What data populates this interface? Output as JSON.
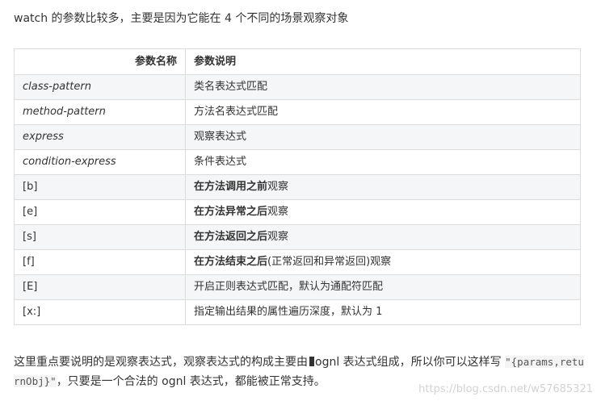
{
  "intro": "watch 的参数比较多，主要是因为它能在 4 个不同的场景观察对象",
  "table": {
    "headers": {
      "name": "参数名称",
      "desc": "参数说明"
    },
    "rows": [
      {
        "name": "class-pattern",
        "desc_bold": "",
        "desc": "类名表达式匹配"
      },
      {
        "name": "method-pattern",
        "desc_bold": "",
        "desc": "方法名表达式匹配"
      },
      {
        "name": "express",
        "desc_bold": "",
        "desc": "观察表达式"
      },
      {
        "name": "condition-express",
        "desc_bold": "",
        "desc": "条件表达式"
      },
      {
        "name": "[b]",
        "desc_bold": "在方法调用之前",
        "desc": "观察"
      },
      {
        "name": "[e]",
        "desc_bold": "在方法异常之后",
        "desc": "观察"
      },
      {
        "name": "[s]",
        "desc_bold": "在方法返回之后",
        "desc": "观察"
      },
      {
        "name": "[f]",
        "desc_bold": "在方法结束之后",
        "desc": "(正常返回和异常返回)观察"
      },
      {
        "name": "[E]",
        "desc_bold": "",
        "desc": "开启正则表达式匹配，默认为通配符匹配"
      },
      {
        "name": "[x:]",
        "desc_bold": "",
        "desc": "指定输出结果的属性遍历深度，默认为 1"
      }
    ]
  },
  "outro": {
    "part1": "这里重点要说明的是观察表达式，观察表达式的构成主要由",
    "part2": "ognl 表达式组成，所以你可以这样写",
    "code": "\"{params,returnObj}\"",
    "part3": "，只要是一个合法的 ognl 表达式，都能被正常支持。"
  },
  "watermark": "https://blog.csdn.net/w57685321"
}
